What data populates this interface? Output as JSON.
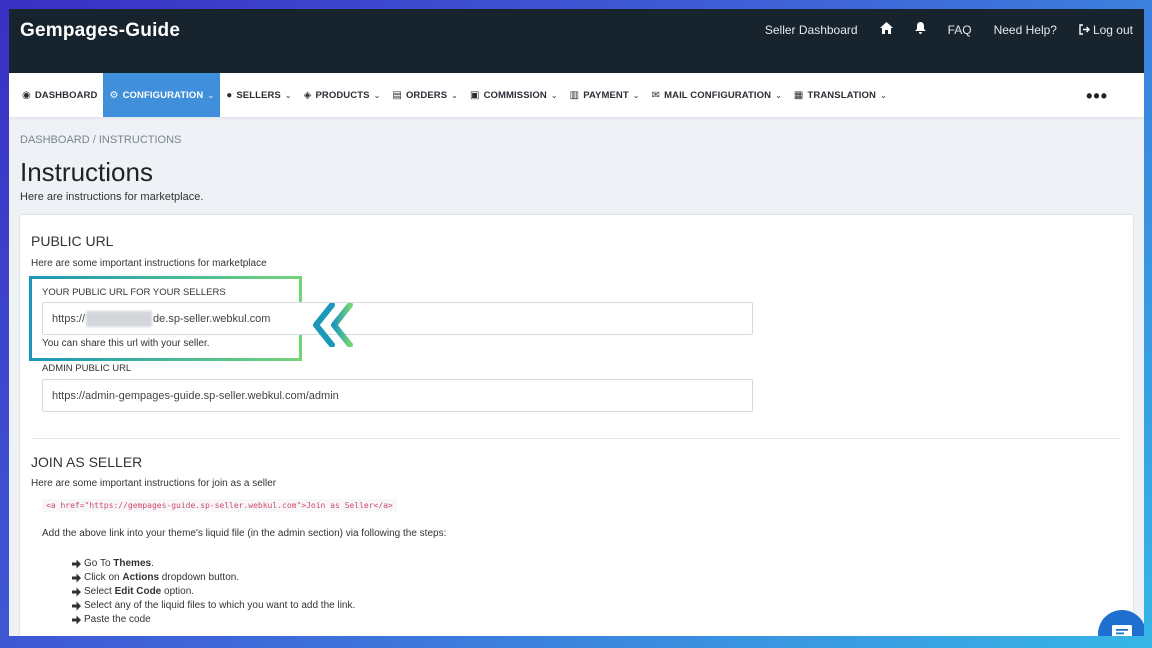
{
  "topbar": {
    "brand": "Gempages-Guide",
    "links": {
      "seller_dashboard": "Seller Dashboard",
      "faq": "FAQ",
      "need_help": "Need Help?",
      "logout": "Log out"
    }
  },
  "nav": {
    "items": [
      {
        "label": "DASHBOARD",
        "icon": "dashboard-icon",
        "glyph": "◉",
        "chevron": ""
      },
      {
        "label": "CONFIGURATION",
        "icon": "gear-icon",
        "glyph": "⚙",
        "chevron": "⌄"
      },
      {
        "label": "SELLERS",
        "icon": "user-icon",
        "glyph": "●",
        "chevron": "⌄"
      },
      {
        "label": "PRODUCTS",
        "icon": "tag-icon",
        "glyph": "◈",
        "chevron": "⌄"
      },
      {
        "label": "ORDERS",
        "icon": "clipboard-icon",
        "glyph": "▤",
        "chevron": "⌄"
      },
      {
        "label": "COMMISSION",
        "icon": "money-icon",
        "glyph": "▣",
        "chevron": "⌄"
      },
      {
        "label": "PAYMENT",
        "icon": "payment-icon",
        "glyph": "▥",
        "chevron": "⌄"
      },
      {
        "label": "MAIL CONFIGURATION",
        "icon": "mail-icon",
        "glyph": "✉",
        "chevron": "⌄"
      },
      {
        "label": "TRANSLATION",
        "icon": "translate-icon",
        "glyph": "▦",
        "chevron": "⌄"
      }
    ],
    "more": "•••",
    "active_index": 1
  },
  "breadcrumb": {
    "home": "DASHBOARD",
    "separator": "/",
    "current": "INSTRUCTIONS"
  },
  "page": {
    "title": "Instructions",
    "subtitle": "Here are instructions for marketplace."
  },
  "public_url": {
    "title": "PUBLIC URL",
    "desc": "Here are some important instructions for marketplace",
    "seller_label": "YOUR PUBLIC URL FOR YOUR SELLERS",
    "seller_url_prefix": "https://",
    "seller_url_suffix": "de.sp-seller.webkul.com",
    "seller_help": "You can share this url with your seller.",
    "admin_label": "ADMIN PUBLIC URL",
    "admin_url": "https://admin-gempages-guide.sp-seller.webkul.com/admin"
  },
  "join": {
    "title": "JOIN AS SELLER",
    "desc": "Here are some important instructions for join as a seller",
    "code": "<a href=\"https://gempages-guide.sp-seller.webkul.com\">Join as Seller</a>",
    "para": "Add the above link into your theme's liquid file (in the admin section) via following the steps:",
    "steps": [
      {
        "pre": "Go To ",
        "bold": "Themes",
        "post": "."
      },
      {
        "pre": "Click on ",
        "bold": "Actions",
        "post": " dropdown button."
      },
      {
        "pre": "Select ",
        "bold": "Edit Code",
        "post": " option."
      },
      {
        "pre": "Select any of the liquid files to which you want to add the link.",
        "bold": "",
        "post": ""
      },
      {
        "pre": "Paste the code",
        "bold": "",
        "post": ""
      }
    ]
  },
  "colors": {
    "topbar": "#17232d",
    "active_nav": "#3f8fda",
    "highlight_start": "#1b97b8",
    "highlight_end": "#74d47a",
    "chat": "#1f6fd0"
  }
}
